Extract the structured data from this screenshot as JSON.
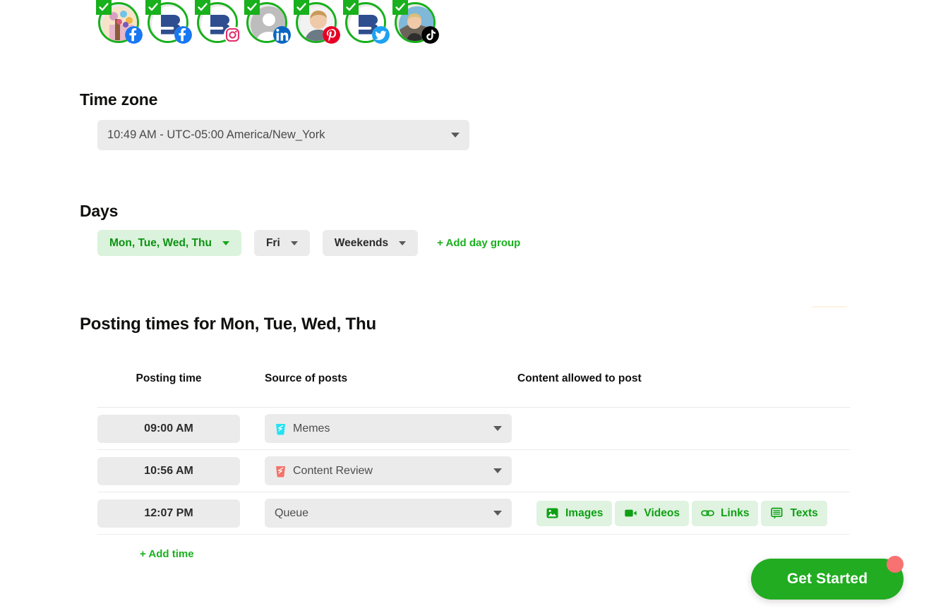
{
  "accounts": [
    {
      "name": "Facebook account 1",
      "platform": "facebook",
      "avatar": "illustration",
      "connected": true
    },
    {
      "name": "Facebook account 2",
      "platform": "facebook",
      "avatar": "logo-ds",
      "connected": true
    },
    {
      "name": "Instagram account",
      "platform": "instagram",
      "avatar": "logo-ds",
      "connected": true
    },
    {
      "name": "LinkedIn account",
      "platform": "linkedin",
      "avatar": "placeholder",
      "connected": true
    },
    {
      "name": "Pinterest account",
      "platform": "pinterest",
      "avatar": "person-photo",
      "connected": true
    },
    {
      "name": "Twitter account",
      "platform": "twitter",
      "avatar": "logo-ds",
      "connected": true
    },
    {
      "name": "TikTok account",
      "platform": "tiktok",
      "avatar": "person-photo2",
      "connected": true
    }
  ],
  "timezone": {
    "heading": "Time zone",
    "current_time": "10:49 AM",
    "separator": "-",
    "zone": "UTC-05:00 America/New_York",
    "value": "10:49 AM - UTC-05:00 America/New_York"
  },
  "days": {
    "heading": "Days",
    "groups": [
      {
        "label": "Mon, Tue, Wed, Thu",
        "active": true
      },
      {
        "label": "Fri",
        "active": false
      },
      {
        "label": "Weekends",
        "active": false
      }
    ],
    "add_label": "+ Add day group"
  },
  "posting": {
    "heading": "Posting times for Mon, Tue, Wed, Thu",
    "columns": {
      "time": "Posting time",
      "source": "Source of posts",
      "allowed": "Content allowed to post"
    },
    "rows": [
      {
        "time": "09:00 AM",
        "source": "Memes",
        "source_icon": "category-cup-icon",
        "source_color": "#25e2f5",
        "allowed": []
      },
      {
        "time": "10:56 AM",
        "source": "Content Review",
        "source_icon": "category-cup-icon",
        "source_color": "#f4736b",
        "allowed": []
      },
      {
        "time": "12:07 PM",
        "source": "Queue",
        "source_icon": "none",
        "source_color": "",
        "allowed": [
          {
            "label": "Images",
            "icon": "image-icon"
          },
          {
            "label": "Videos",
            "icon": "video-icon"
          },
          {
            "label": "Links",
            "icon": "link-icon"
          },
          {
            "label": "Texts",
            "icon": "text-bubble-icon"
          }
        ]
      }
    ],
    "add_time_label": "+ Add time"
  },
  "cta": {
    "label": "Get Started",
    "has_notification_dot": true
  },
  "colors": {
    "green": "#19b01d",
    "green_dark": "#0d9212",
    "green_light_bg": "#dff3e0",
    "chip_gray": "#ebebeb",
    "cta_green": "#22ac22",
    "notification_dot": "#f97272"
  }
}
